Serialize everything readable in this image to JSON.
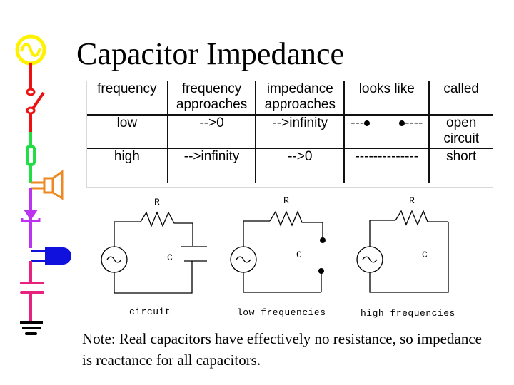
{
  "slide": {
    "title": "Capacitor Impedance",
    "note": "Note: Real capacitors have effectively no resistance, so impedance is reactance for all capacitors."
  },
  "sidebar": {
    "symbols": [
      {
        "name": "ac-source",
        "color": "#ffee22"
      },
      {
        "name": "switch",
        "color": "#ee1111"
      },
      {
        "name": "fuse",
        "color": "#22dd44"
      },
      {
        "name": "speaker",
        "color": "#ee8822"
      },
      {
        "name": "diode",
        "color": "#bb33ee"
      },
      {
        "name": "and-gate",
        "color": "#1111dd"
      },
      {
        "name": "capacitor",
        "color": "#e8207e"
      },
      {
        "name": "ground",
        "color": "#000000"
      }
    ]
  },
  "table": {
    "headers": [
      "frequency",
      "frequency approaches",
      "impedance approaches",
      "looks like",
      "called"
    ],
    "rows": [
      {
        "frequency": "low",
        "frequency_approaches": "-->0",
        "impedance_approaches": "-->infinity",
        "looks_like_left": "---",
        "looks_like_right": "----",
        "called": "open circuit"
      },
      {
        "frequency": "high",
        "frequency_approaches": "-->infinity",
        "impedance_approaches": "-->0",
        "looks_like": "--------------",
        "called": "short"
      }
    ]
  },
  "circuits": [
    {
      "label": "circuit",
      "resistor": "R",
      "capacitor": "C"
    },
    {
      "label": "low frequencies",
      "resistor": "R",
      "capacitor": "C"
    },
    {
      "label": "high frequencies",
      "resistor": "R",
      "capacitor": "C"
    }
  ]
}
